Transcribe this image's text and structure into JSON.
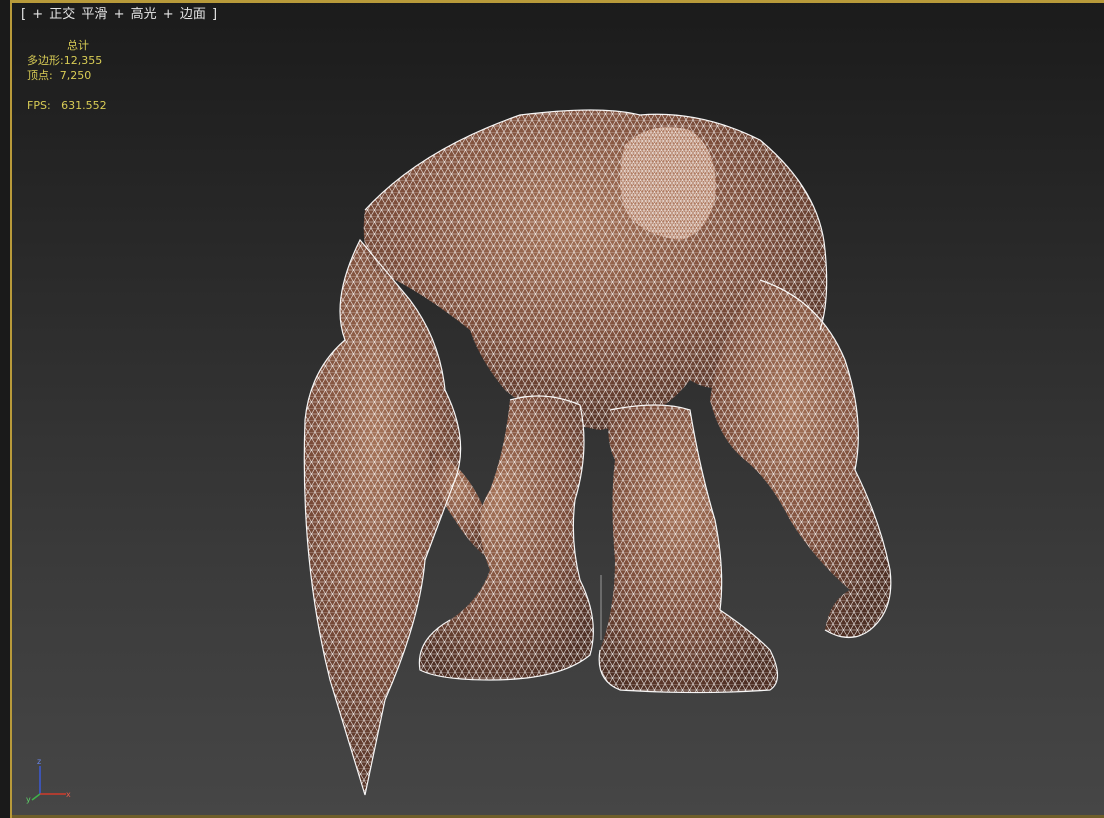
{
  "viewport": {
    "label": {
      "open": "[",
      "plus": "+",
      "view": "正交",
      "mode": "平滑",
      "shade": "高光",
      "edges": "边面",
      "close": "]"
    },
    "stats": {
      "header": "总计",
      "polys_label": "多边形:",
      "polys_value": "12,355",
      "verts_label": "顶点:",
      "verts_value": "7,250",
      "fps_label": "FPS:",
      "fps_value": "631.552"
    },
    "axis_labels": {
      "z": "z",
      "x": "x",
      "y": "y"
    }
  },
  "colors": {
    "border_active": "#b89a3a",
    "stats_text": "#d8cc55",
    "label_text": "#e4e4e4",
    "mesh_fill": "#7a4e3a",
    "wire": "#ffffff",
    "axis_x": "#d23b2b",
    "axis_y": "#3fb34a",
    "axis_z": "#3b5ad6"
  },
  "scene": {
    "object": "stone-golem-wireframe-mesh",
    "shading": "smooth-highlight-edged-faces"
  }
}
